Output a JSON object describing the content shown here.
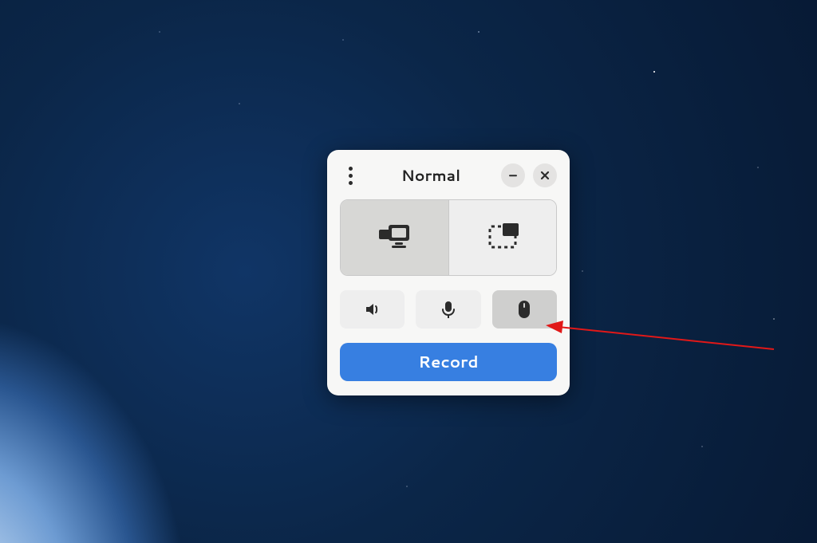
{
  "window": {
    "title": "Normal",
    "menu_icon": "more-vertical-icon",
    "minimize_icon": "minimize-icon",
    "close_icon": "close-icon"
  },
  "modes": {
    "screen": {
      "icon": "screens-icon",
      "selected": true
    },
    "area": {
      "icon": "selection-icon",
      "selected": false
    }
  },
  "toggles": {
    "speaker": {
      "icon": "speaker-icon",
      "active": false
    },
    "microphone": {
      "icon": "microphone-icon",
      "active": false
    },
    "pointer": {
      "icon": "mouse-icon",
      "active": true
    }
  },
  "record_button": {
    "label": "Record"
  },
  "colors": {
    "accent": "#377fe1",
    "arrow": "#e11818"
  },
  "annotation": {
    "type": "arrow",
    "target": "pointer-toggle"
  }
}
